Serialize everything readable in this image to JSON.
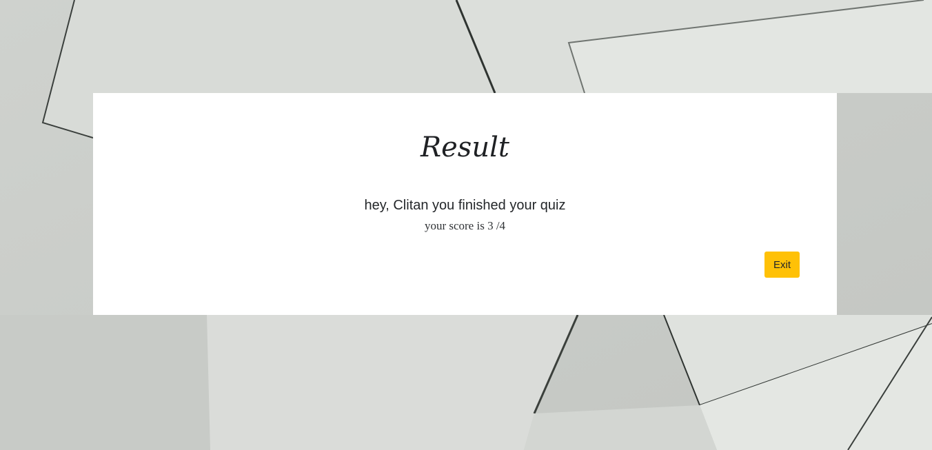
{
  "result": {
    "title": "Result",
    "greeting": "hey, Clitan you finished your quiz",
    "score_text": "your score is 3 /4",
    "score": 3,
    "total": 4,
    "exit_label": "Exit"
  },
  "colors": {
    "background": "#d6d9d5",
    "card": "#ffffff",
    "exit_button": "#ffc107",
    "text": "#212529"
  }
}
